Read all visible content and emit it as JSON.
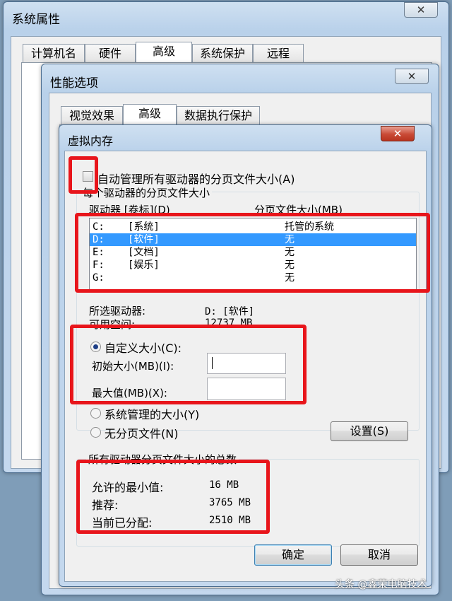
{
  "sys_props": {
    "title": "系统属性",
    "close": "✕",
    "tabs": [
      "计算机名",
      "硬件",
      "高级",
      "系统保护",
      "远程"
    ]
  },
  "perf_options": {
    "title": "性能选项",
    "close": "✕",
    "tabs": [
      "视觉效果",
      "高级",
      "数据执行保护"
    ]
  },
  "vm": {
    "title": "虚拟内存",
    "close": "✕",
    "auto_manage_label": "自动管理所有驱动器的分页文件大小(A)",
    "auto_manage_checked": false,
    "per_drive_group_label": "每个驱动器的分页文件大小",
    "drive_col_header": "驱动器 [卷标](D)",
    "size_col_header": "分页文件大小(MB)",
    "drives": [
      {
        "drive": "C:",
        "label": "[系统]",
        "size": "托管的系统",
        "selected": false
      },
      {
        "drive": "D:",
        "label": "[软件]",
        "size": "无",
        "selected": true
      },
      {
        "drive": "E:",
        "label": "[文档]",
        "size": "无",
        "selected": false
      },
      {
        "drive": "F:",
        "label": "[娱乐]",
        "size": "无",
        "selected": false
      },
      {
        "drive": "G:",
        "label": "",
        "size": "无",
        "selected": false
      }
    ],
    "selected_drive_label": "所选驱动器:",
    "selected_drive_value": "D:  [软件]",
    "available_space_label": "可用空间:",
    "available_space_value": "12737 MB",
    "custom_size_label": "自定义大小(C):",
    "initial_size_label": "初始大小(MB)(I):",
    "initial_size_value": "",
    "max_size_label": "最大值(MB)(X):",
    "max_size_value": "",
    "system_managed_label": "系统管理的大小(Y)",
    "no_paging_label": "无分页文件(N)",
    "set_button": "设置(S)",
    "totals_group_label": "所有驱动器分页文件大小的总数",
    "min_allowed_label": "允许的最小值:",
    "min_allowed_value": "16 MB",
    "recommended_label": "推荐:",
    "recommended_value": "3765 MB",
    "allocated_label": "当前已分配:",
    "allocated_value": "2510 MB",
    "ok_button": "确定",
    "cancel_button": "取消"
  },
  "watermark": "头条 @鑫荣电脑技术"
}
